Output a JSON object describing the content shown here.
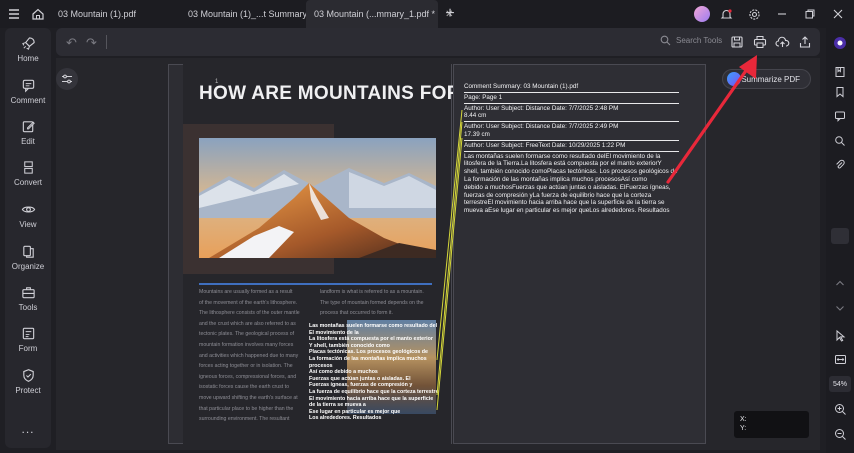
{
  "tabs": [
    {
      "label": "03 Mountain (1).pdf",
      "active": false
    },
    {
      "label": "03 Mountain (1)_...t Summary.pdf *",
      "active": false
    },
    {
      "label": "03 Mountain (...mmary_1.pdf *",
      "active": true
    }
  ],
  "sidebar": {
    "items": [
      {
        "label": "Home",
        "icon": "rocket-icon"
      },
      {
        "label": "Comment",
        "icon": "comment-icon"
      },
      {
        "label": "Edit",
        "icon": "edit-icon"
      },
      {
        "label": "Convert",
        "icon": "convert-icon"
      },
      {
        "label": "View",
        "icon": "eye-icon"
      },
      {
        "label": "Organize",
        "icon": "organize-icon"
      },
      {
        "label": "Tools",
        "icon": "toolbox-icon"
      },
      {
        "label": "Form",
        "icon": "form-icon"
      },
      {
        "label": "Protect",
        "icon": "shield-icon"
      }
    ],
    "more": "..."
  },
  "toolbar": {
    "search_label": "Search Tools"
  },
  "summarize_button": "Summarize PDF",
  "document": {
    "page_number": "1",
    "title": "HOW ARE MOUNTAINS FORMED?",
    "col1": [
      "Mountains are usually formed as a result",
      "of the movement of the earth's lithosphere.",
      "The lithosphere consists of the outer mantle",
      "and the crust which are also referred to as",
      "tectonic plates. The geological process of",
      "mountain formation involves many forces",
      "and activities which happened due to many",
      "forces acting together or in isolation. The",
      "igneous forces, compressional forces, and",
      "isostatic forces cause the earth crust to",
      "move upward shifting the earth's surface at",
      "that particular place to be higher than the",
      "surrounding environment. The resultant"
    ],
    "col2": [
      "landform is what is referred to as a mountain.",
      "The type of mountain formed depends on the",
      "process that occurred to form it."
    ],
    "overlay_lines": [
      "Las montañas suelen formarse como resultado del",
      "El movimiento de la",
      "La litosfera está compuesta por el manto exterior",
      "Y shell, también conocido como",
      "Placas tectónicas. Los procesos geológicos de",
      "La formación de las montañas implica muchos",
      "procesos",
      "Así como debido a muchos",
      "Fuerzas que actúan juntas o aisladas. El",
      "Fuerzas ígneas, fuerzas de compresión y",
      "La fuerza de equilibrio hace que la corteza terrestre",
      "El movimiento hacia arriba hace que la superficie",
      "de la tierra se mueva a",
      "Ese lugar en particular es mejor que",
      "Los alrededores. Resultados"
    ]
  },
  "summary": {
    "header": "Comment Summary: 03 Mountain (1).pdf",
    "page": "Page: Page 1",
    "entries": [
      {
        "line": "Author: User   Subject: Distance     Date: 7/7/2025 2:48 PM",
        "detail": "8.44 cm"
      },
      {
        "line": "Author: User   Subject: Distance     Date: 7/7/2025 2:49 PM",
        "detail": "17.39 cm"
      },
      {
        "line": "Author: User   Subject: FreeText     Date: 10/29/2025 1:22 PM",
        "detail": ""
      }
    ],
    "text_lines": [
      "Las montañas suelen formarse como resultado delEl movimiento de la",
      "litosfera de la Tierra.La litosfera está compuesta por el manto exteriorY",
      "shell, también conocido comoPlacas tectónicas. Los procesos geológicos de",
      "La formación de las montañas implica muchos procesosAsí como",
      "debido a muchosFuerzas que actúan juntas o aisladas. ElFuerzas ígneas,",
      "fuerzas de compresión yLa fuerza de equilibrio hace que la corteza",
      "terrestreEl movimiento hacia arriba hace que la superficie de la tierra se",
      "mueva aEse lugar en particular es mejor queLos alrededores. Resultados"
    ]
  },
  "coordinates": {
    "x_label": "X:",
    "y_label": "Y:"
  },
  "zoom": "54%",
  "colors": {
    "accent": "#e8283a",
    "page_bg": "#2d2d33",
    "link_line": "#d6d83a"
  }
}
